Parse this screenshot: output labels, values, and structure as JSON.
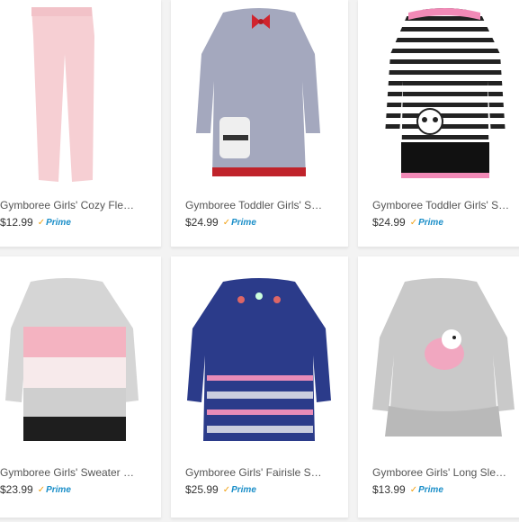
{
  "prime_label": "Prime",
  "products": [
    {
      "title": "Gymboree Girls' Cozy Fleece Leggings",
      "price": "$12.99",
      "icon": "pink-leggings-image"
    },
    {
      "title": "Gymboree Toddler Girls' Sweater Dress",
      "price": "$24.99",
      "icon": "gray-sweater-dress-image"
    },
    {
      "title": "Gymboree Toddler Girls' Striped Sweater Dress",
      "price": "$24.99",
      "icon": "striped-panda-dress-image"
    },
    {
      "title": "Gymboree Girls' Sweater Dress",
      "price": "$23.99",
      "icon": "colorblock-sweater-dress-image"
    },
    {
      "title": "Gymboree Girls' Fairisle Sweater Dress",
      "price": "$25.99",
      "icon": "navy-fairisle-dress-image"
    },
    {
      "title": "Gymboree Girls' Long Sleeve Tunic",
      "price": "$13.99",
      "icon": "gray-bird-tunic-image"
    }
  ]
}
